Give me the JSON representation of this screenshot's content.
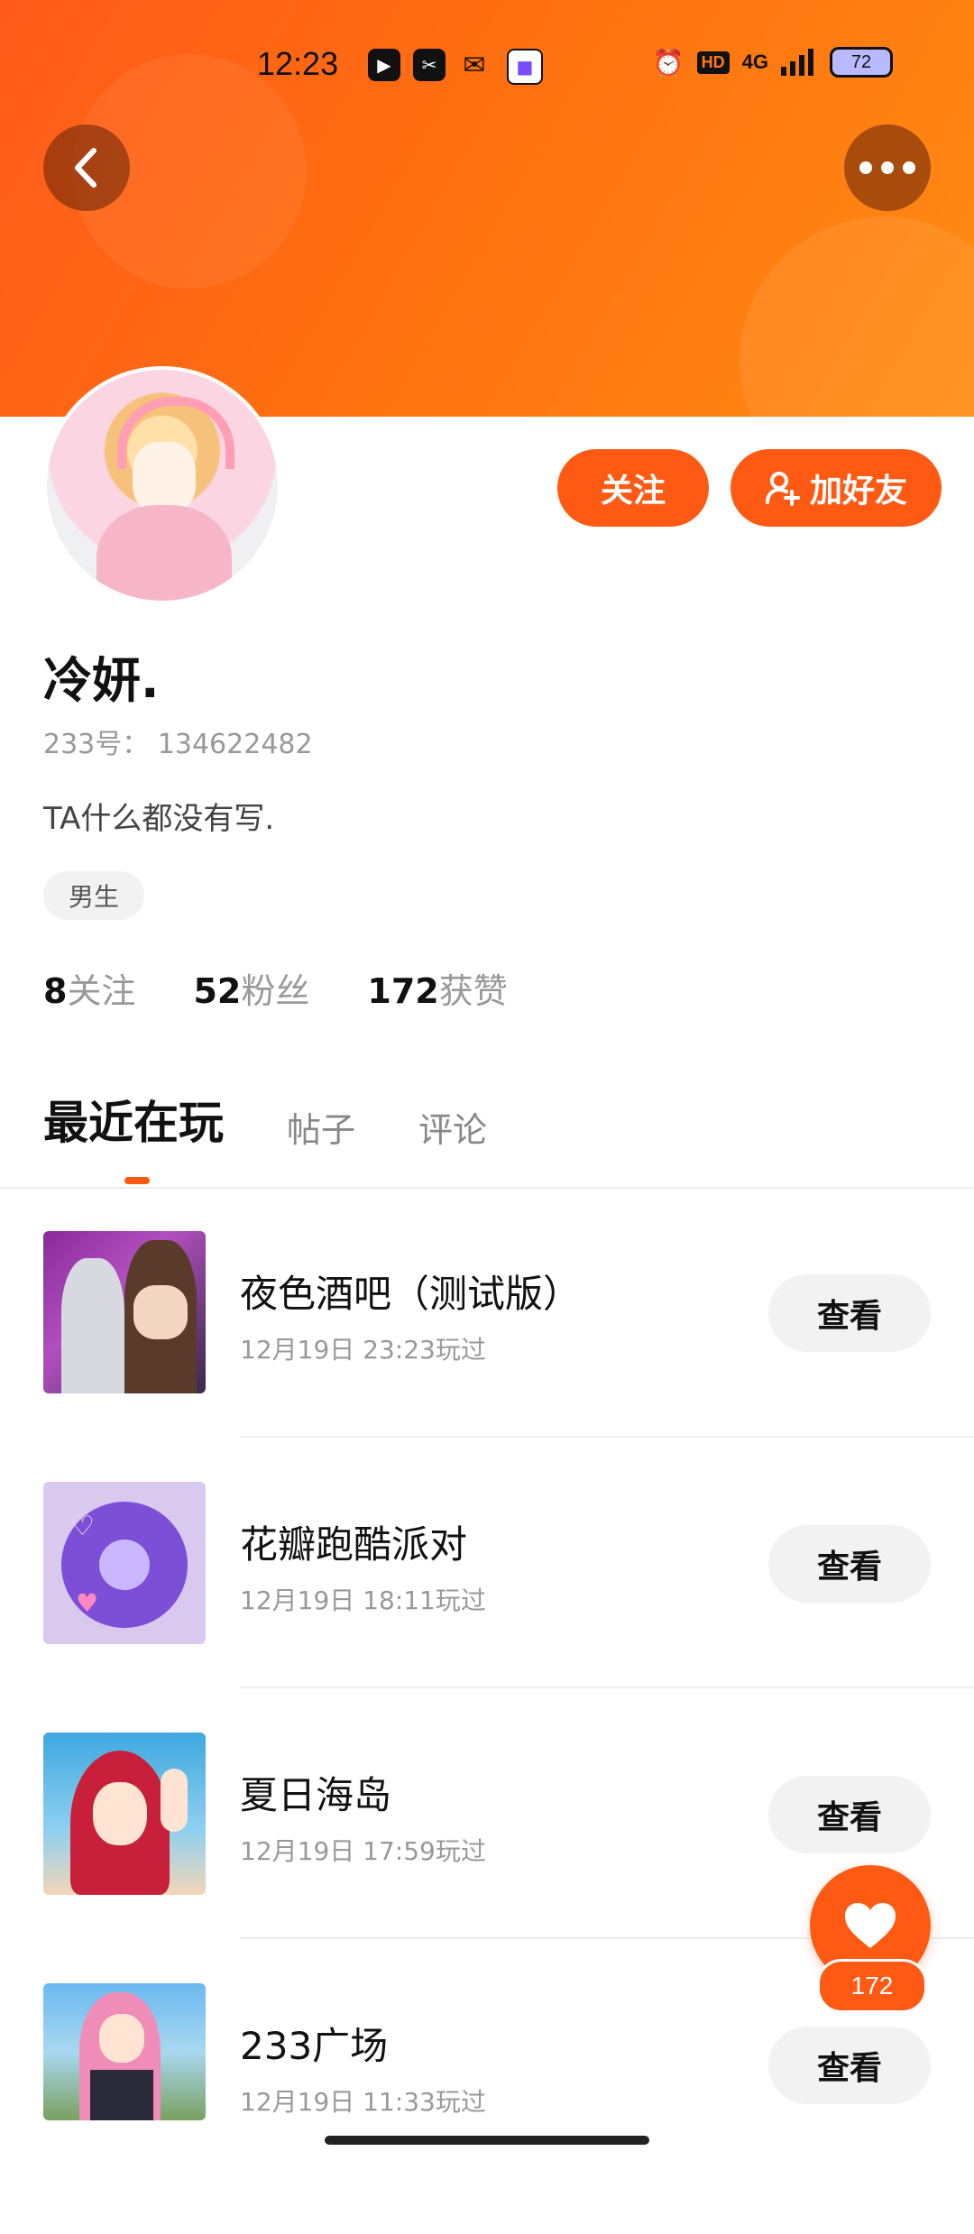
{
  "status_bar": {
    "time": "12:23",
    "hd": "HD",
    "network": "4G",
    "battery": "72"
  },
  "profile": {
    "nickname": "冷妍.",
    "uid": "233号： 134622482",
    "bio": "TA什么都没有写.",
    "gender": "男生",
    "follow_label": "关注",
    "add_friend_label": "加好友"
  },
  "stats": [
    {
      "num": "8",
      "label": "关注"
    },
    {
      "num": "52",
      "label": "粉丝"
    },
    {
      "num": "172",
      "label": "获赞"
    }
  ],
  "tabs": [
    "最近在玩",
    "帖子",
    "评论"
  ],
  "games": [
    {
      "name": "夜色酒吧（测试版）",
      "time": "12月19日 23:23玩过",
      "button": "查看"
    },
    {
      "name": "花瓣跑酷派对",
      "time": "12月19日 18:11玩过",
      "button": "查看"
    },
    {
      "name": "夏日海岛",
      "time": "12月19日 17:59玩过",
      "button": "查看"
    },
    {
      "name": "233广场",
      "time": "12月19日 11:33玩过",
      "button": "查看"
    }
  ],
  "like_fab": {
    "count": "172"
  },
  "colors": {
    "accent": "#ff5a14",
    "header_start": "#ff5a1a",
    "header_end": "#ff8c14"
  }
}
